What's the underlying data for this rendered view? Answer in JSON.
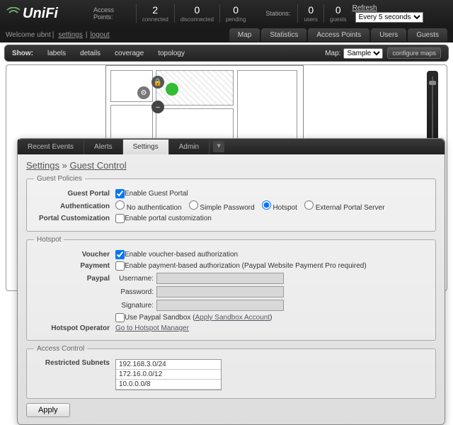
{
  "brand": "UniFi",
  "header": {
    "ap_label": "Access Points:",
    "ap_connected": "2",
    "ap_connected_sub": "connected",
    "ap_disconnected": "0",
    "ap_disconnected_sub": "disconnected",
    "ap_pending": "0",
    "ap_pending_sub": "pending",
    "st_label": "Stations:",
    "st_users": "0",
    "st_users_sub": "users",
    "st_guests": "0",
    "st_guests_sub": "guests",
    "refresh_label": "Refresh",
    "refresh_value": "Every 5 seconds"
  },
  "subhdr": {
    "welcome": "Welcome ubnt",
    "settings": "settings",
    "logout": "logout"
  },
  "nav": {
    "tabs": [
      "Map",
      "Statistics",
      "Access Points",
      "Users",
      "Guests"
    ]
  },
  "ctrl": {
    "show": "Show:",
    "opts": [
      "labels",
      "details",
      "coverage",
      "topology"
    ],
    "map": "Map:",
    "map_val": "Sample",
    "cfg": "configure maps"
  },
  "dialog": {
    "tabs": [
      "Recent Events",
      "Alerts",
      "Settings",
      "Admin"
    ],
    "active": 2,
    "breadcrumb": {
      "a": "Settings",
      "b": "Guest Control"
    },
    "gp": {
      "legend": "Guest Policies",
      "portal_lab": "Guest Portal",
      "portal_cb": "Enable Guest Portal",
      "auth_lab": "Authentication",
      "auth_opts": [
        "No authentication",
        "Simple Password",
        "Hotspot",
        "External Portal Server"
      ],
      "pcust_lab": "Portal Customization",
      "pcust_cb": "Enable portal customization"
    },
    "hs": {
      "legend": "Hotspot",
      "voucher_lab": "Voucher",
      "voucher_cb": "Enable voucher-based authorization",
      "pay_lab": "Payment",
      "pay_cb": "Enable payment-based authorization (Paypal Website Payment Pro required)",
      "pp_lab": "Paypal",
      "u": "Username:",
      "p": "Password:",
      "s": "Signature:",
      "sandbox_cb": "Use Paypal Sandbox",
      "sandbox_lnk": "Apply Sandbox Account",
      "op_lab": "Hotspot Operator",
      "op_lnk": "Go to Hotspot Manager"
    },
    "ac": {
      "legend": "Access Control",
      "sub_lab": "Restricted Subnets",
      "subnets": [
        "192.168.3.0/24",
        "172.16.0.0/12",
        "10.0.0.0/8"
      ]
    },
    "apply": "Apply"
  }
}
